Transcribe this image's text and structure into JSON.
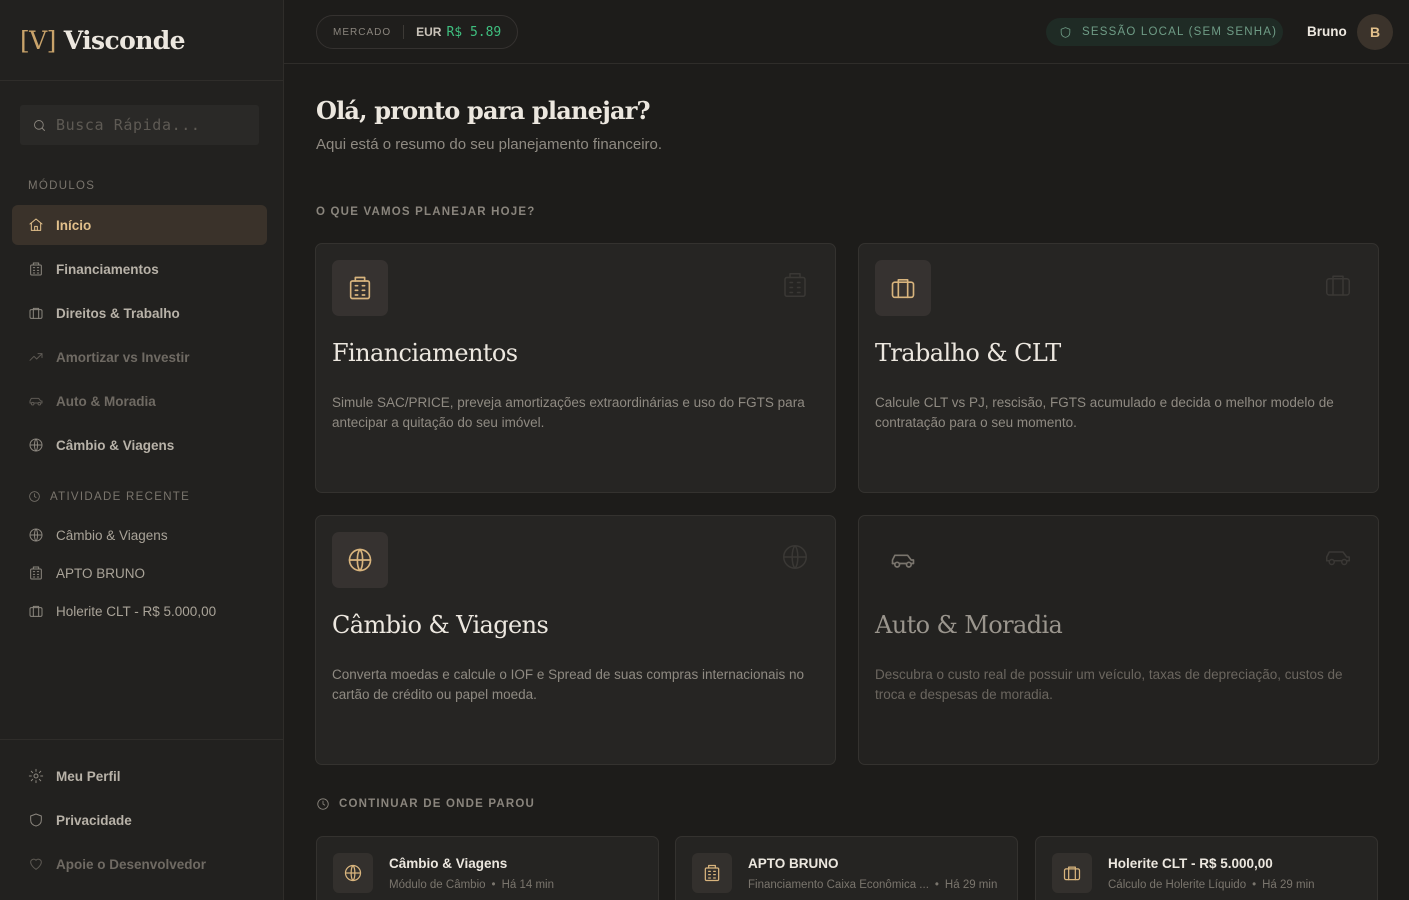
{
  "app": {
    "logo_mark": "[V]",
    "logo_name": "Visconde"
  },
  "search": {
    "placeholder": "Busca Rápida..."
  },
  "sidebar": {
    "modules_title": "MÓDULOS",
    "modules": [
      {
        "label": "Início",
        "icon": "home-icon"
      },
      {
        "label": "Financiamentos",
        "icon": "building-icon"
      },
      {
        "label": "Direitos & Trabalho",
        "icon": "briefcase-icon"
      },
      {
        "label": "Amortizar vs Investir",
        "icon": "trending-up-icon"
      },
      {
        "label": "Auto & Moradia",
        "icon": "car-icon"
      },
      {
        "label": "Câmbio & Viagens",
        "icon": "globe-icon"
      }
    ],
    "recent_title": "ATIVIDADE RECENTE",
    "recent": [
      {
        "label": "Câmbio & Viagens",
        "icon": "globe-icon"
      },
      {
        "label": "APTO BRUNO",
        "icon": "building-icon"
      },
      {
        "label": "Holerite CLT - R$ 5.000,00",
        "icon": "briefcase-icon"
      }
    ],
    "bottom": [
      {
        "label": "Meu Perfil",
        "icon": "gear-icon"
      },
      {
        "label": "Privacidade",
        "icon": "shield-icon"
      },
      {
        "label": "Apoie o Desenvolvedor",
        "icon": "heart-icon"
      }
    ]
  },
  "topbar": {
    "market_label": "MERCADO",
    "currency": "EUR",
    "rate": "R$ 5.89",
    "session": "SESSÃO LOCAL (SEM SENHA)",
    "user": "Bruno",
    "avatar_initial": "B"
  },
  "main": {
    "greeting": "Olá, pronto para planejar?",
    "subtitle": "Aqui está o resumo do seu planejamento financeiro.",
    "plan_title": "O QUE VAMOS PLANEJAR HOJE?",
    "cards": [
      {
        "title": "Financiamentos",
        "desc": "Simule SAC/PRICE, preveja amortizações extraordinárias e uso do FGTS para antecipar a quitação do seu imóvel.",
        "icon": "building-icon"
      },
      {
        "title": "Trabalho & CLT",
        "desc": "Calcule CLT vs PJ, rescisão, FGTS acumulado e decida o melhor modelo de contratação para o seu momento.",
        "icon": "briefcase-icon"
      },
      {
        "title": "Câmbio & Viagens",
        "desc": "Converta moedas e calcule o IOF e Spread de suas compras internacionais no cartão de crédito ou papel moeda.",
        "icon": "globe-icon"
      },
      {
        "title": "Auto & Moradia",
        "desc": "Descubra o custo real de possuir um veículo, taxas de depreciação, custos de troca e despesas de moradia.",
        "icon": "car-icon"
      }
    ],
    "continue_title": "CONTINUAR DE ONDE PAROU",
    "continue": [
      {
        "title": "Câmbio & Viagens",
        "meta": "Módulo de Câmbio",
        "time": "Há 14 min",
        "icon": "globe-icon"
      },
      {
        "title": "APTO BRUNO",
        "meta": "Financiamento Caixa Econômica ...",
        "time": "Há 29 min",
        "icon": "building-icon"
      },
      {
        "title": "Holerite CLT - R$ 5.000,00",
        "meta": "Cálculo de Holerite Líquido",
        "time": "Há 29 min",
        "icon": "briefcase-icon"
      }
    ]
  },
  "colors": {
    "accent": "#e2c08b",
    "rate_green": "#3fbf7f",
    "background": "#1d1c1a",
    "sidebar": "#22211f"
  }
}
